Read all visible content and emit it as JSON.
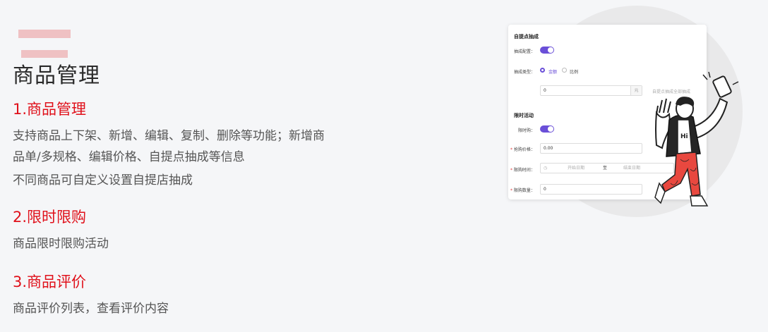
{
  "page": {
    "title": "商品管理"
  },
  "sections": [
    {
      "heading": "1.商品管理",
      "lines": [
        "支持商品上下架、新增、编辑、复制、删除等功能；新增商",
        "品单/多规格、编辑价格、自提点抽成等信息",
        "不同商品可自定义设置自提店抽成"
      ]
    },
    {
      "heading": "2.限时限购",
      "lines": [
        "商品限时限购活动"
      ]
    },
    {
      "heading": "3.商品评价",
      "lines": [
        "商品评价列表，查看评价内容"
      ]
    }
  ],
  "card": {
    "section1_title": "自提点抽成",
    "commission_config_label": "抽成配置：",
    "commission_type_label": "抽成类型：",
    "type_options": [
      "金额",
      "比例"
    ],
    "amount_value": "0",
    "amount_suffix": "元",
    "hint": "自提点抽成全部抽成",
    "section2_title": "限时活动",
    "flash_label": "限时购：",
    "price_label": "抢购价格：",
    "price_value": "0.00",
    "time_label": "限购时间：",
    "time_start_placeholder": "开始日期",
    "time_sep": "至",
    "time_end_placeholder": "结束日期",
    "qty_label": "限购数量：",
    "qty_value": "0",
    "required_mark": "*"
  },
  "illustration": {
    "shirt_text": "Hi"
  },
  "colors": {
    "accent_red": "#e0101a",
    "toggle_purple": "#6a4fd8",
    "deco_pink": "#efc1c3"
  }
}
